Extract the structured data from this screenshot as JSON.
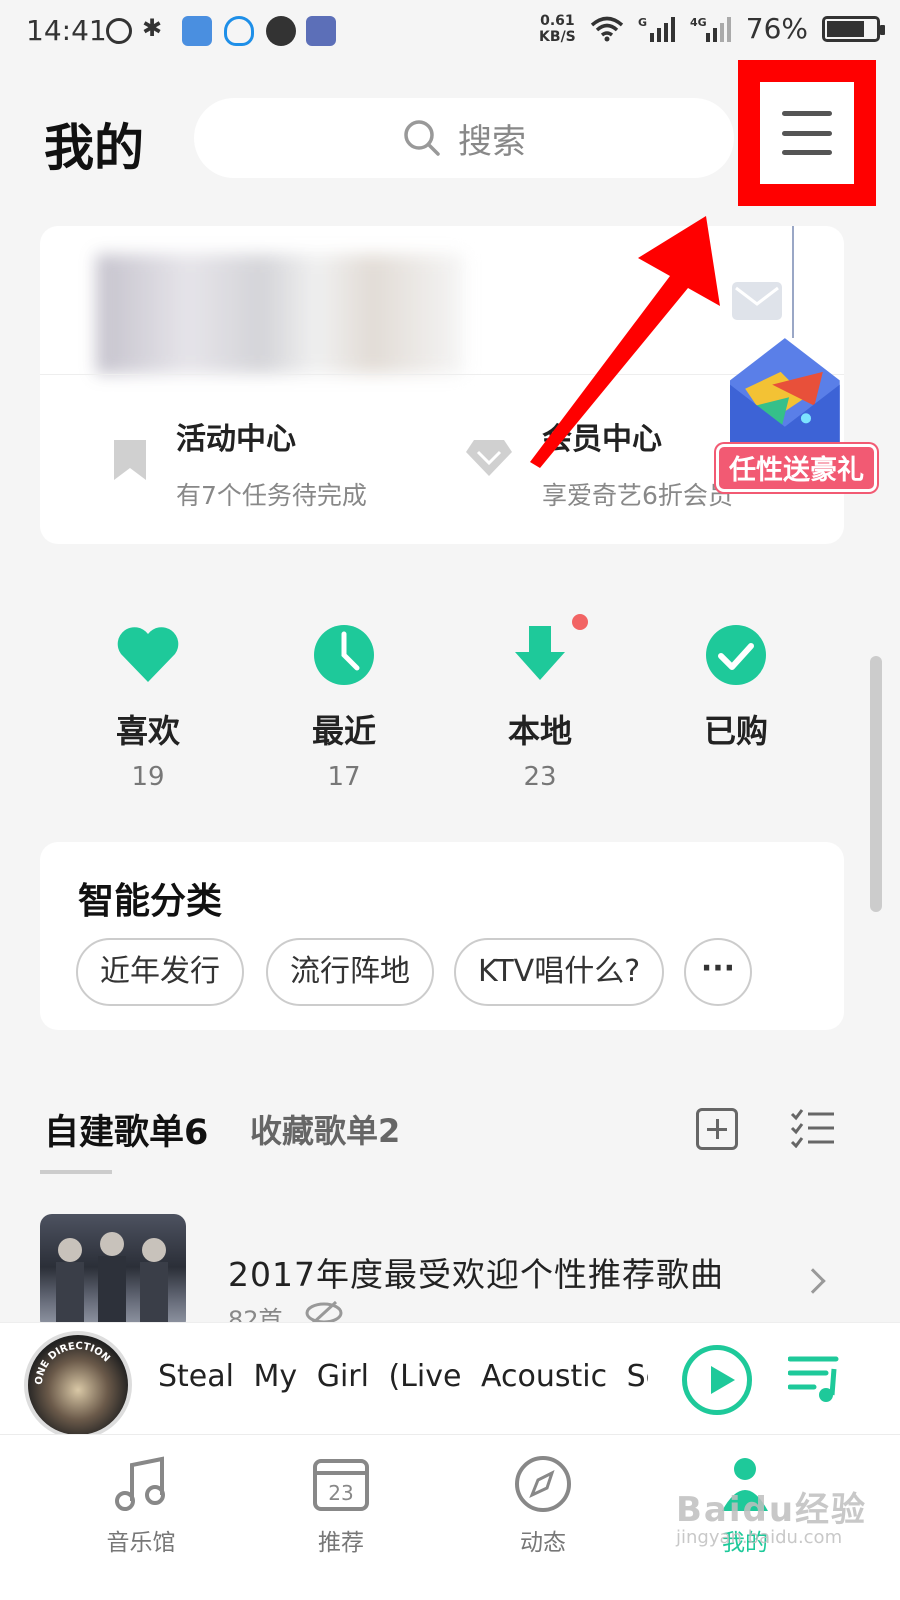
{
  "status_bar": {
    "time": "14:41",
    "net_speed_value": "0.61",
    "net_speed_unit": "KB/S",
    "battery": "76%",
    "signal_labels": [
      "G",
      "4G"
    ]
  },
  "header": {
    "title": "我的",
    "search_placeholder": "搜索"
  },
  "profile_card": {
    "features": [
      {
        "title": "活动中心",
        "subtitle": "有7个任务待完成"
      },
      {
        "title": "会员中心",
        "subtitle": "享爱奇艺6折会员"
      }
    ],
    "gift_label": "任性送豪礼"
  },
  "quick_access": [
    {
      "label": "喜欢",
      "count": "19"
    },
    {
      "label": "最近",
      "count": "17"
    },
    {
      "label": "本地",
      "count": "23"
    },
    {
      "label": "已购",
      "count": ""
    }
  ],
  "smart_categories": {
    "title": "智能分类",
    "chips": [
      "近年发行",
      "流行阵地",
      "KTV唱什么?"
    ],
    "more": "···"
  },
  "playlists": {
    "tab_own": "自建歌单6",
    "tab_fav": "收藏歌单2",
    "items": [
      {
        "title": "2017年度最受欢迎个性推荐歌曲",
        "count": "82首"
      }
    ]
  },
  "mini_player": {
    "song": "Steal My Girl (Live Acoustic Session)",
    "album_text": "ONE DIRECTION"
  },
  "bottom_nav": [
    {
      "label": "音乐馆"
    },
    {
      "label": "推荐",
      "icon_text": "23"
    },
    {
      "label": "动态"
    },
    {
      "label": "我的"
    }
  ],
  "watermark": {
    "text": "Baidu经验",
    "sub": "jingyan.baidu.com"
  },
  "colors": {
    "accent": "#1ec99a",
    "highlight_red": "#ff0000",
    "badge": "#f25a73"
  }
}
